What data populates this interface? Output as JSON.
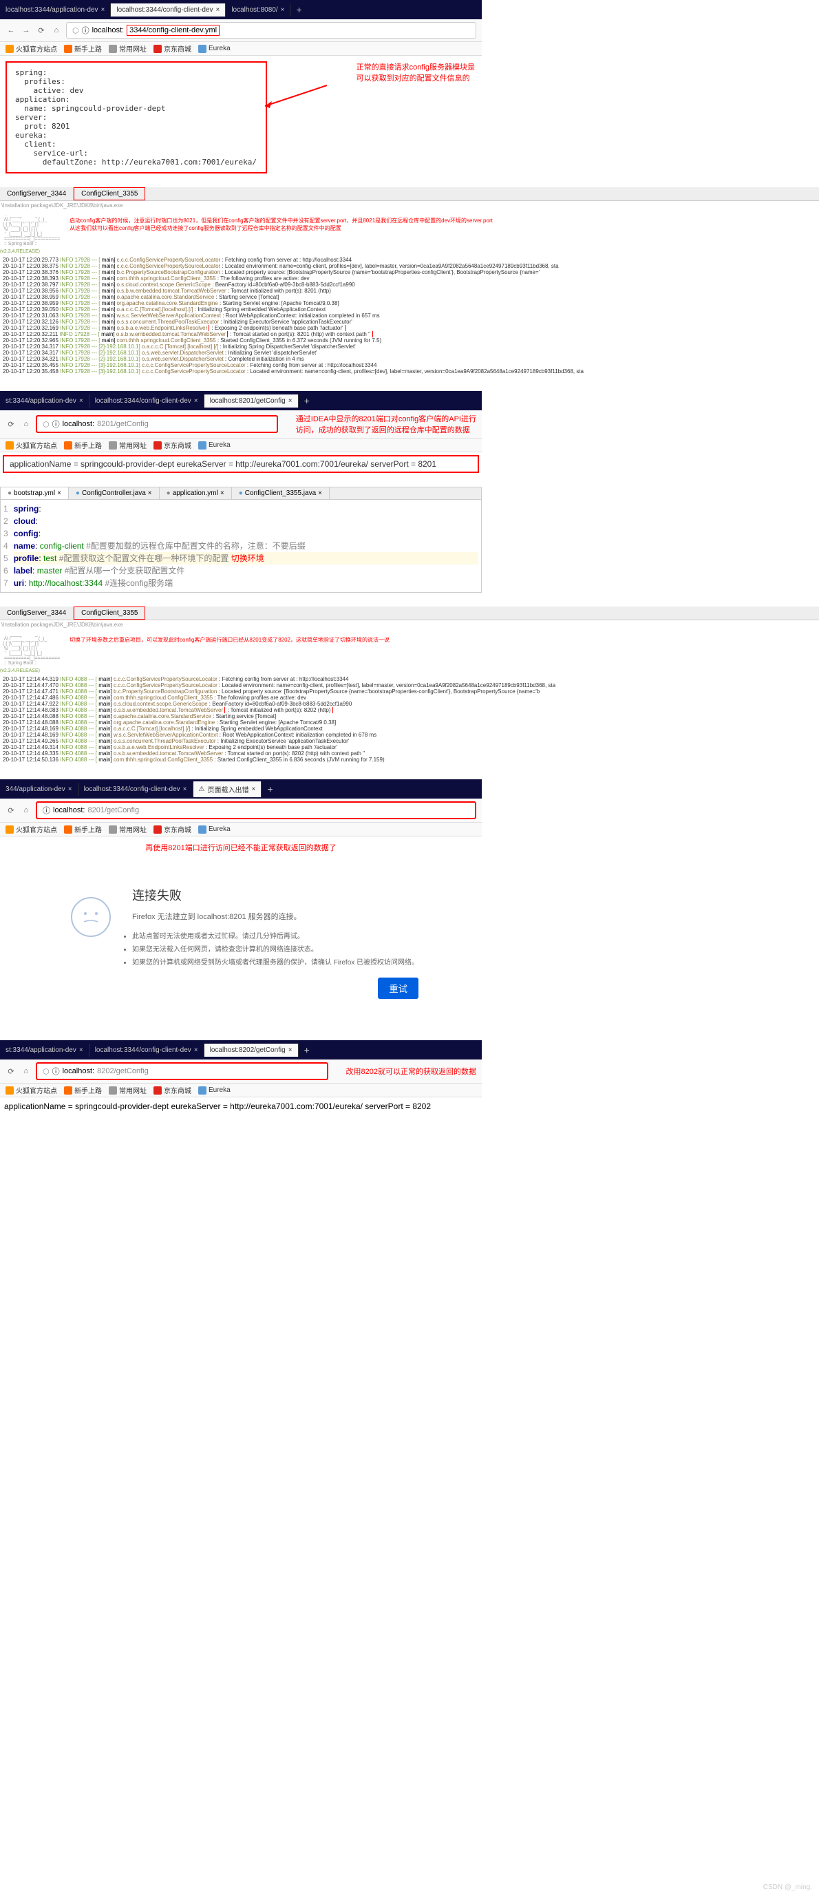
{
  "s1": {
    "tabs": [
      {
        "label": "localhost:3344/application-dev",
        "active": false
      },
      {
        "label": "localhost:3344/config-client-dev",
        "active": true
      },
      {
        "label": "localhost:8080/",
        "active": false
      }
    ],
    "url_prefix": "localhost:",
    "url_suffix": "3344/config-client-dev.yml",
    "annotation_l1": "正常的直接请求config服务器模块是",
    "annotation_l2": "可以获取到对应的配置文件信息的",
    "yaml": "spring:\n  profiles:\n    active: dev\napplication:\n  name: springcould-provider-dept\nserver:\n  prot: 8201\neureka:\n  client:\n    service-url:\n      defaultZone: http://eureka7001.com:7001/eureka/"
  },
  "bookmarks": {
    "items": [
      {
        "label": "火狐官方站点",
        "color": "#ff9500"
      },
      {
        "label": "新手上路",
        "color": "#ff6b00"
      },
      {
        "label": "常用网址",
        "color": "#999"
      },
      {
        "label": "京东商城",
        "color": "#e1251b"
      },
      {
        "label": "Eureka",
        "color": "#5b9bd5"
      }
    ]
  },
  "s2": {
    "tab1": "ConfigServer_3344",
    "tab2": "ConfigClient_3355",
    "path": "\\Installation package\\JDK_JRE\\JDK8\\bin\\java.exe",
    "red_line1": "启动config客户端的时候，注意运行时端口也为8021，但是我们在config客户端的配置文件中并没有配置server.port，并且8021是我们在远程仓库中配置的dev环境的server.port",
    "red_line2": "从这我们就可以看出config客户端已经成功连接了config服务器读取到了远程仓库中指定名称的配置文件中的配置",
    "spring_version": "(v2.3.4.RELEASE)",
    "log_lines": [
      {
        "ts": "20-10-17 12:20:29.773",
        "lvl": "INFO 17928 --- [",
        "th": "main]",
        "cls": "c.c.c.ConfigServicePropertySourceLocator",
        "msg": ": Fetching config from server at : http://localhost:3344"
      },
      {
        "ts": "20-10-17 12:20:38.375",
        "lvl": "INFO 17928 --- [",
        "th": "main]",
        "cls": "c.c.c.ConfigServicePropertySourceLocator",
        "msg": ": Located environment: name=config-client, profiles=[dev], label=master, version=0ca1ea9A9f2082a5648a1ce92497189cb93f11bd368, sta"
      },
      {
        "ts": "20-10-17 12:20:38.376",
        "lvl": "INFO 17928 --- [",
        "th": "main]",
        "cls": "b.c.PropertySourceBootstrapConfiguration",
        "msg": ": Located property source: [BootstrapPropertySource {name='bootstrapProperties-configClient'}, BootstrapPropertySource {name='"
      },
      {
        "ts": "20-10-17 12:20:38.393",
        "lvl": "INFO 17928 --- [",
        "th": "main]",
        "cls": "com.thhh.springcloud.ConfigClient_3355",
        "msg": ": The following profiles are active: dev"
      },
      {
        "ts": "20-10-17 12:20:38.797",
        "lvl": "INFO 17928 --- [",
        "th": "main]",
        "cls": "o.s.cloud.context.scope.GenericScope",
        "msg": ": BeanFactory id=80cbf6a0-af09-3bc8-b883-5dd2ccf1a990"
      },
      {
        "ts": "20-10-17 12:20:38.956",
        "lvl": "INFO 17928 --- [",
        "th": "main]",
        "cls": "o.s.b.w.embedded.tomcat.TomcatWebServer",
        "msg": ": Tomcat initialized with port(s): 8201 (http)"
      },
      {
        "ts": "20-10-17 12:20:38.959",
        "lvl": "INFO 17928 --- [",
        "th": "main]",
        "cls": "o.apache.catalina.core.StandardService",
        "msg": ": Starting service [Tomcat]"
      },
      {
        "ts": "20-10-17 12:20:38.959",
        "lvl": "INFO 17928 --- [",
        "th": "main]",
        "cls": "org.apache.catalina.core.StandardEngine",
        "msg": ": Starting Servlet engine: [Apache Tomcat/9.0.38]"
      },
      {
        "ts": "20-10-17 12:20:39.050",
        "lvl": "INFO 17928 --- [",
        "th": "main]",
        "cls": "o.a.c.c.C.[Tomcat].[localhost].[/]",
        "msg": ": Initializing Spring embedded WebApplicationContext"
      },
      {
        "ts": "20-10-17 12:20:31.063",
        "lvl": "INFO 17928 --- [",
        "th": "main]",
        "cls": "w.s.c.ServletWebServerApplicationContext",
        "msg": ": Root WebApplicationContext: initialization completed in 657 ms"
      },
      {
        "ts": "20-10-17 12:20:32.126",
        "lvl": "INFO 17928 --- [",
        "th": "main]",
        "cls": "o.s.s.concurrent.ThreadPoolTaskExecutor",
        "msg": ": Initializing ExecutorService 'applicationTaskExecutor'"
      },
      {
        "ts": "20-10-17 12:20:32.169",
        "lvl": "INFO 17928 --- [",
        "th": "main]",
        "cls": "o.s.b.a.e.web.EndpointLinksResolver",
        "msg": ": Exposing 2 endpoint(s) beneath base path '/actuator'",
        "boxed": true
      },
      {
        "ts": "20-10-17 12:20:32.211",
        "lvl": "INFO 17928 --- [",
        "th": "main]",
        "cls": "o.s.b.w.embedded.tomcat.TomcatWebServer",
        "msg": ": Tomcat started on port(s): 8201 (http) with context path ''",
        "boxed": true
      },
      {
        "ts": "20-10-17 12:20:32.965",
        "lvl": "INFO 17928 --- [",
        "th": "main]",
        "cls": "com.thhh.springcloud.ConfigClient_3355",
        "msg": ": Started ConfigClient_3355 in 6.372 seconds (JVM running for 7.5)"
      },
      {
        "ts": "20-10-17 12:20:34.317",
        "lvl": "INFO 17928 --- [2]-192.168.10.1]",
        "th": "",
        "cls": "o.a.c.c.C.[Tomcat].[localhost].[/]",
        "msg": ": Initializing Spring DispatcherServlet 'dispatcherServlet'"
      },
      {
        "ts": "20-10-17 12:20:34.317",
        "lvl": "INFO 17928 --- [2]-192.168.10.1]",
        "th": "",
        "cls": "o.s.web.servlet.DispatcherServlet",
        "msg": ": Initializing Servlet 'dispatcherServlet'"
      },
      {
        "ts": "20-10-17 12:20:34.321",
        "lvl": "INFO 17928 --- [2]-192.168.10.1]",
        "th": "",
        "cls": "o.s.web.servlet.DispatcherServlet",
        "msg": ": Completed initialization in 4 ms"
      },
      {
        "ts": "20-10-17 12:20:35.455",
        "lvl": "INFO 17928 --- [3]-192.168.10.1]",
        "th": "",
        "cls": "c.c.c.ConfigServicePropertySourceLocator",
        "msg": ": Fetching config from server at : http://localhost:3344"
      },
      {
        "ts": "20-10-17 12:20:35.458",
        "lvl": "INFO 17928 --- [3]-192.168.10.1]",
        "th": "",
        "cls": "c.c.c.ConfigServicePropertySourceLocator",
        "msg": ": Located environment: name=config-client, profiles=[dev], label=master, version=0ca1ea9A9f2082a5648a1ce92497189cb93f11bd368, sta"
      }
    ]
  },
  "s3": {
    "tabs": [
      {
        "label": "st:3344/application-dev",
        "active": false
      },
      {
        "label": "localhost:3344/config-client-dev",
        "active": false
      },
      {
        "label": "localhost:8201/getConfig",
        "active": true
      }
    ],
    "url_prefix": "localhost:",
    "url_suffix": "8201/getConfig",
    "annotation_l1": "通过IDEA中显示的8201端口对config客户端的API进行",
    "annotation_l2": "访问，成功的获取到了返回的远程仓库中配置的数据",
    "result": "applicationName = springcould-provider-dept eurekaServer = http://eureka7001.com:7001/eureka/ serverPort = 8201"
  },
  "s4": {
    "tabs": [
      {
        "label": "bootstrap.yml",
        "icon": "#888"
      },
      {
        "label": "ConfigController.java",
        "icon": "#5b9bd5"
      },
      {
        "label": "application.yml",
        "icon": "#888"
      },
      {
        "label": "ConfigClient_3355.java",
        "icon": "#5b9bd5"
      }
    ],
    "lines": [
      {
        "n": "1",
        "txt": "spring:",
        "cls": "kw"
      },
      {
        "n": "2",
        "txt": "  cloud:",
        "cls": "kw"
      },
      {
        "n": "3",
        "txt": "    config:",
        "cls": "kw"
      },
      {
        "n": "4",
        "txt": "      name: config-client",
        "cmt": " #配置要加载的远程仓库中配置文件的名称，注意：不要后缀"
      },
      {
        "n": "5",
        "txt": "      profile: test",
        "cmt": " #配置获取这个配置文件在哪一种环境下的配置",
        "red": "  切换环境",
        "hl": true
      },
      {
        "n": "6",
        "txt": "      label: master",
        "cmt": " #配置从哪一个分支获取配置文件"
      },
      {
        "n": "7",
        "txt": "      uri: http://localhost:3344",
        "cmt": "  #连接config服务端"
      }
    ]
  },
  "s5": {
    "tab1": "ConfigServer_3344",
    "tab2": "ConfigClient_3355",
    "path": "\\Installation package\\JDK_JRE\\JDK8\\bin\\java.exe",
    "red_line": "切换了环境参数之后重启项目，可以发现此时config客户端运行端口已经从8201变成了8202，这就简单地验证了切换环境的说法一说",
    "spring_version": "(v2.3.4.RELEASE)",
    "log_lines": [
      {
        "ts": "20-10-17 12:14:44.319",
        "lvl": "INFO 4088 --- [",
        "th": "main]",
        "cls": "c.c.c.ConfigServicePropertySourceLocator",
        "msg": ": Fetching config from server at : http://localhost:3344"
      },
      {
        "ts": "20-10-17 12:14:47.470",
        "lvl": "INFO 4088 --- [",
        "th": "main]",
        "cls": "c.c.c.ConfigServicePropertySourceLocator",
        "msg": ": Located environment: name=config-client, profiles=[test], label=master, version=0ca1ea9A9f2082a5648a1ce92497189cb93f11bd368, sta"
      },
      {
        "ts": "20-10-17 12:14:47.471",
        "lvl": "INFO 4088 --- [",
        "th": "main]",
        "cls": "b.c.PropertySourceBootstrapConfiguration",
        "msg": ": Located property source: [BootstrapPropertySource {name='bootstrapProperties-configClient'}, BootstrapPropertySource {name='b"
      },
      {
        "ts": "20-10-17 12:14:47.486",
        "lvl": "INFO 4088 --- [",
        "th": "main]",
        "cls": "com.thhh.springcloud.ConfigClient_3355",
        "msg": ": The following profiles are active: dev"
      },
      {
        "ts": "20-10-17 12:14:47.922",
        "lvl": "INFO 4088 --- [",
        "th": "main]",
        "cls": "o.s.cloud.context.scope.GenericScope",
        "msg": ": BeanFactory id=80cbf6a0-af09-3bc8-b883-5dd2ccf1a990"
      },
      {
        "ts": "20-10-17 12:14:48.083",
        "lvl": "INFO 4088 --- [",
        "th": "main]",
        "cls": "o.s.b.w.embedded.tomcat.TomcatWebServer",
        "msg": ": Tomcat initialized with port(s): 8202 (http)",
        "boxed": true
      },
      {
        "ts": "20-10-17 12:14:48.088",
        "lvl": "INFO 4088 --- [",
        "th": "main]",
        "cls": "o.apache.catalina.core.StandardService",
        "msg": ": Starting service [Tomcat]"
      },
      {
        "ts": "20-10-17 12:14:48.088",
        "lvl": "INFO 4088 --- [",
        "th": "main]",
        "cls": "org.apache.catalina.core.StandardEngine",
        "msg": ": Starting Servlet engine: [Apache Tomcat/9.0.38]"
      },
      {
        "ts": "20-10-17 12:14:48.169",
        "lvl": "INFO 4088 --- [",
        "th": "main]",
        "cls": "o.a.c.c.C.[Tomcat].[localhost].[/]",
        "msg": ": Initializing Spring embedded WebApplicationContext"
      },
      {
        "ts": "20-10-17 12:14:48.169",
        "lvl": "INFO 4088 --- [",
        "th": "main]",
        "cls": "w.s.c.ServletWebServerApplicationContext",
        "msg": ": Root WebApplicationContext: initialization completed in 678 ms"
      },
      {
        "ts": "20-10-17 12:14:49.265",
        "lvl": "INFO 4088 --- [",
        "th": "main]",
        "cls": "o.s.s.concurrent.ThreadPoolTaskExecutor",
        "msg": ": Initializing ExecutorService 'applicationTaskExecutor'"
      },
      {
        "ts": "20-10-17 12:14:49.314",
        "lvl": "INFO 4088 --- [",
        "th": "main]",
        "cls": "o.s.b.a.e.web.EndpointLinksResolver",
        "msg": ": Exposing 2 endpoint(s) beneath base path '/actuator'"
      },
      {
        "ts": "20-10-17 12:14:49.335",
        "lvl": "INFO 4088 --- [",
        "th": "main]",
        "cls": "o.s.b.w.embedded.tomcat.TomcatWebServer",
        "msg": ": Tomcat started on port(s): 8202 (http) with context path ''"
      },
      {
        "ts": "20-10-17 12:14:50.136",
        "lvl": "INFO 4088 --- [",
        "th": "main]",
        "cls": "com.thhh.springcloud.ConfigClient_3355",
        "msg": ": Started ConfigClient_3355 in 6.836 seconds (JVM running for 7.159)"
      }
    ]
  },
  "s6": {
    "tabs": [
      {
        "label": "344/application-dev",
        "active": false
      },
      {
        "label": "localhost:3344/config-client-dev",
        "active": false
      },
      {
        "label": "页面载入出错",
        "active": true,
        "warn": true
      }
    ],
    "url_prefix": "localhost:",
    "url_suffix": "8201/getConfig",
    "red_line": "再使用8201端口进行访问已经不能正常获取返回的数据了",
    "error_title": "连接失败",
    "error_sub": "Firefox 无法建立到 localhost:8201 服务器的连接。",
    "bullets": [
      "此站点暂时无法使用或者太过忙碌。请过几分钟后再试。",
      "如果您无法载入任何网页，请检查您计算机的网络连接状态。",
      "如果您的计算机或网络受到防火墙或者代理服务器的保护，请确认 Firefox 已被授权访问网络。"
    ],
    "retry": "重试"
  },
  "s7": {
    "tabs": [
      {
        "label": "st:3344/application-dev",
        "active": false
      },
      {
        "label": "localhost:3344/config-client-dev",
        "active": false
      },
      {
        "label": "localhost:8202/getConfig",
        "active": true
      }
    ],
    "url_prefix": "localhost:",
    "url_suffix": "8202/getConfig",
    "red_line": "改用8202就可以正常的获取返回的数据",
    "result": "applicationName = springcould-provider-dept eurekaServer = http://eureka7001.com:7001/eureka/ serverPort = 8202"
  },
  "watermark": "CSDN @_ming."
}
